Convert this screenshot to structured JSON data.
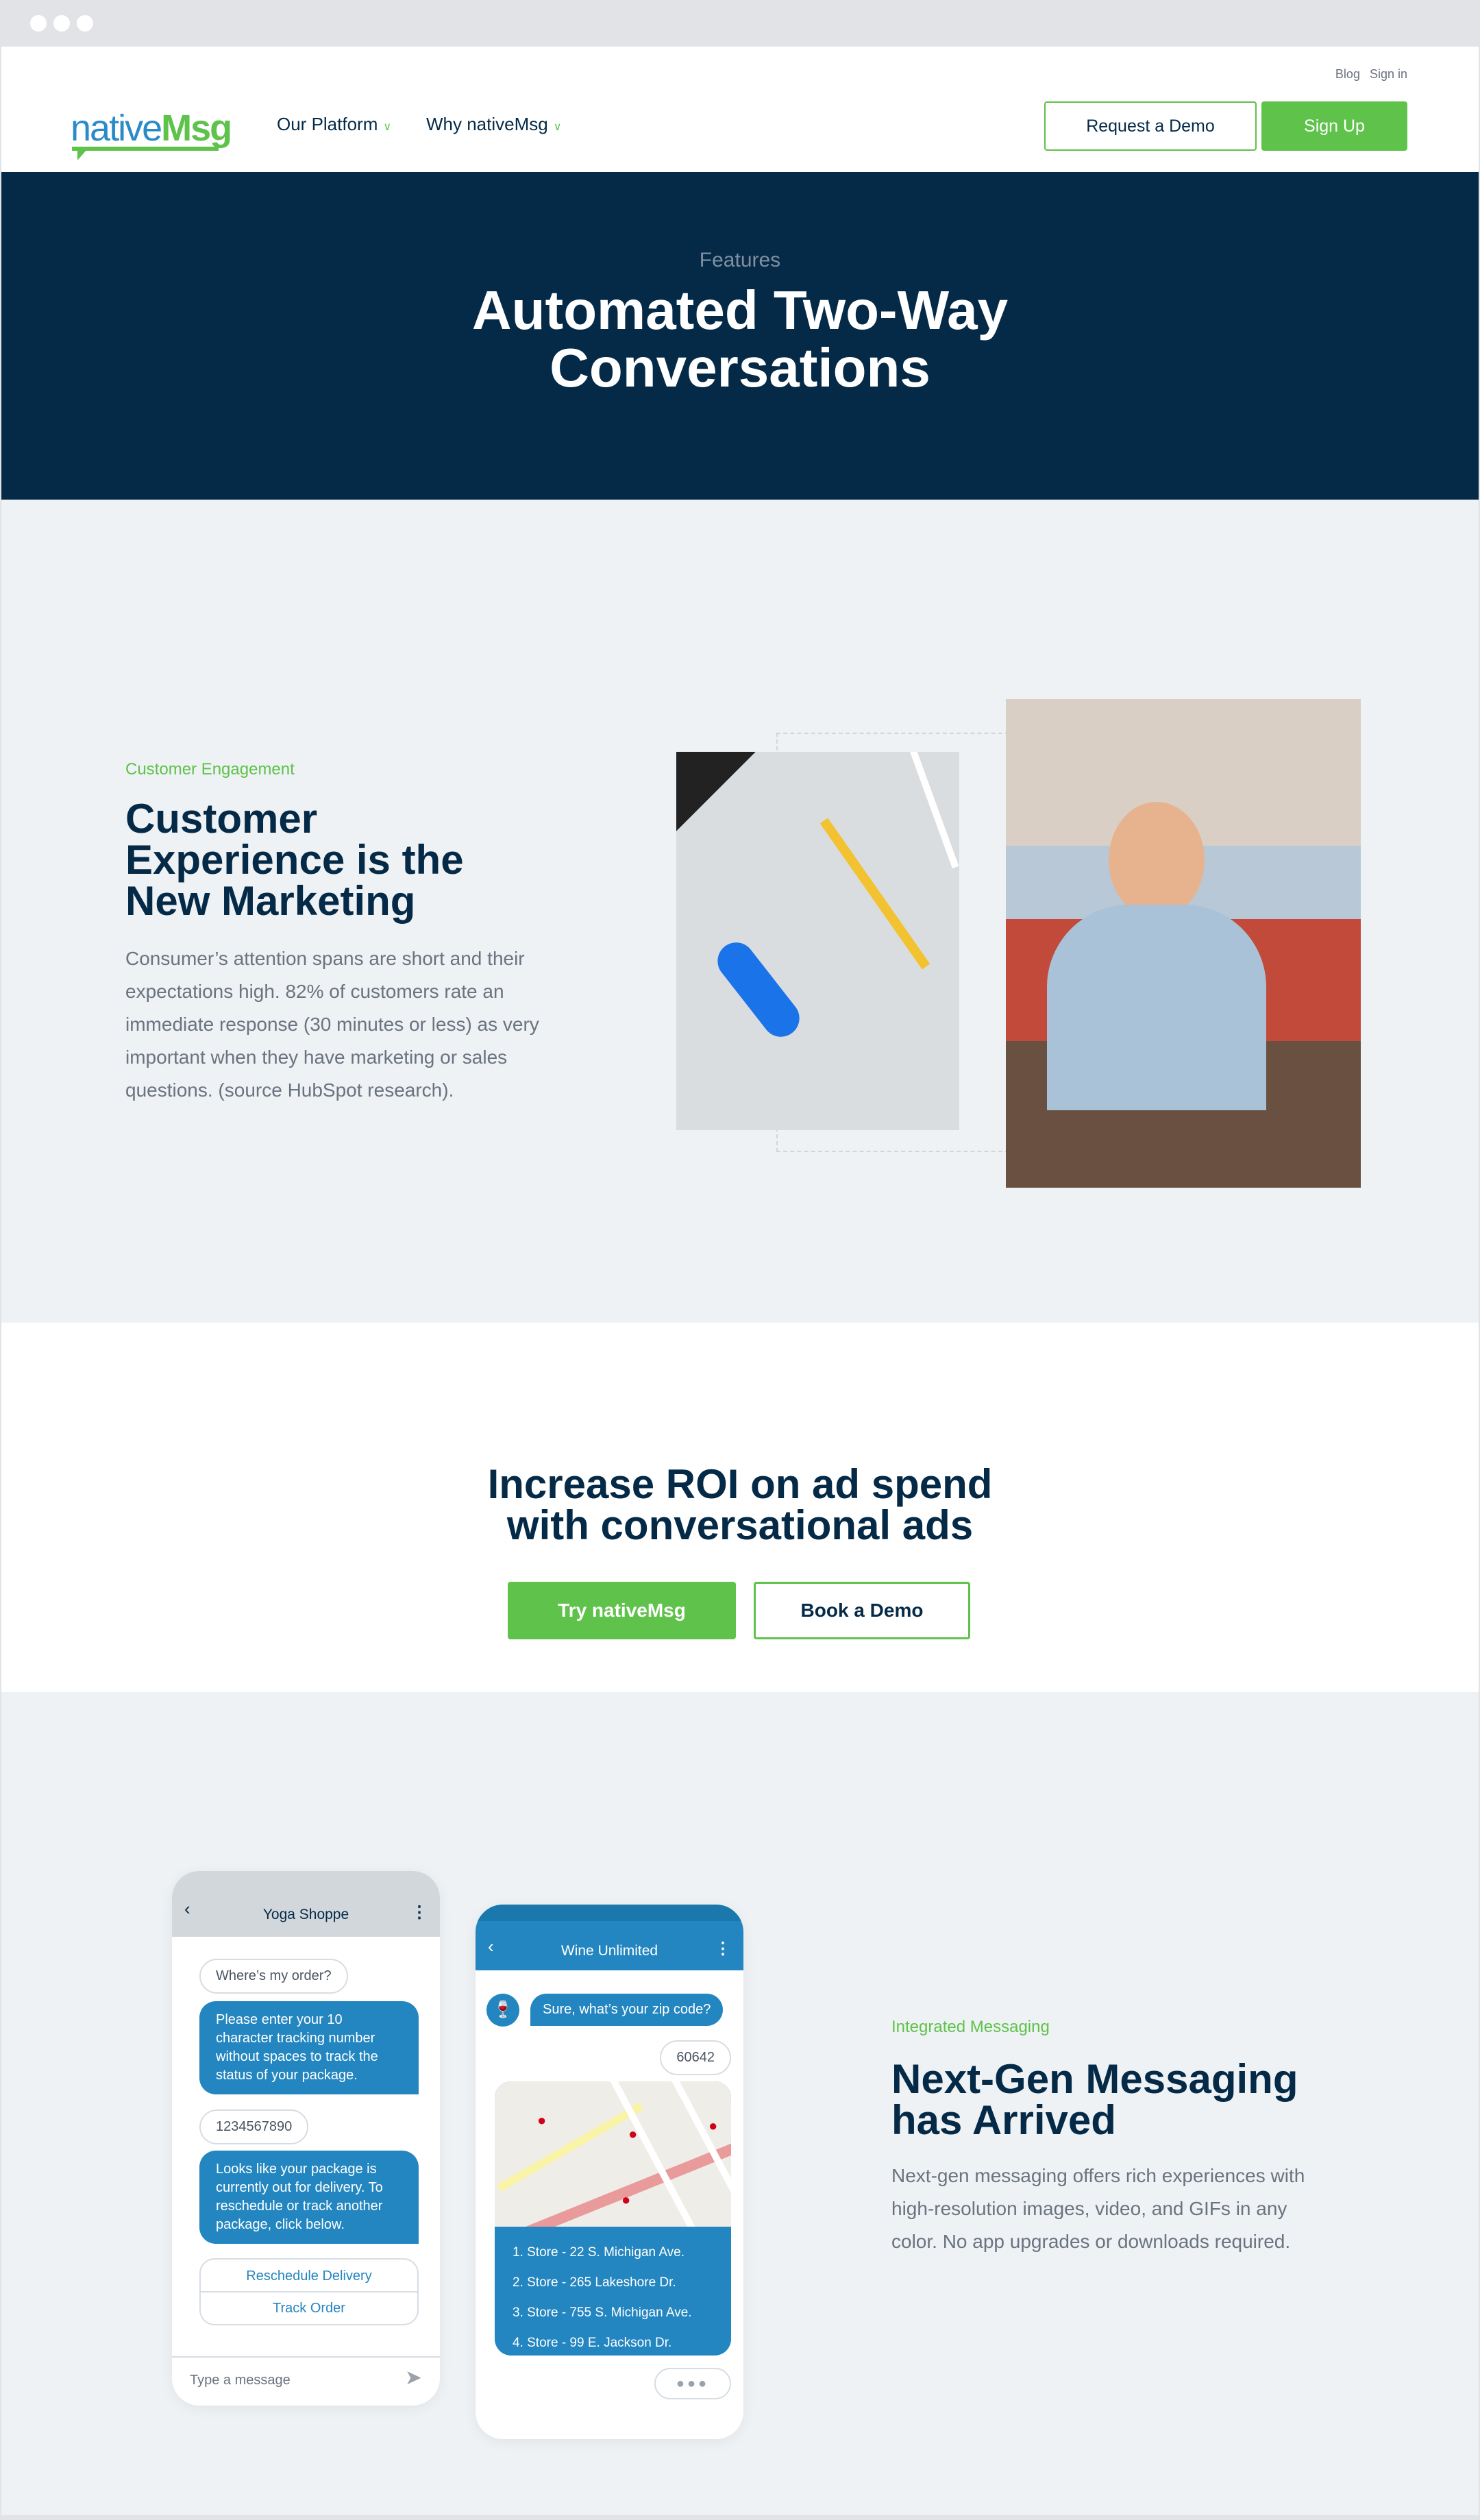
{
  "browser": {
    "dots": 3
  },
  "header": {
    "top_links": [
      "Blog",
      "Sign in"
    ],
    "logo": {
      "part1": "native",
      "part2": "Msg"
    },
    "nav": [
      {
        "label": "Our Platform"
      },
      {
        "label": "Why nativeMsg"
      }
    ],
    "request_demo": "Request a Demo",
    "sign_up": "Sign Up"
  },
  "hero": {
    "eyebrow": "Features",
    "title_line1": "Automated Two-Way",
    "title_line2": "Conversations"
  },
  "engagement": {
    "eyebrow": "Customer Engagement",
    "title_lines": [
      "Customer",
      "Experience is the",
      "New Marketing"
    ],
    "body": "Consumer’s attention spans are short and their expectations high. 82% of customers rate an immediate response (30 minutes or less) as very important when they have marketing or sales questions. (source HubSpot research)."
  },
  "cta": {
    "title_line1": "Increase ROI on ad spend",
    "title_line2": "with conversational ads",
    "primary": "Try nativeMsg",
    "secondary": "Book a Demo"
  },
  "messaging": {
    "eyebrow": "Integrated Messaging",
    "title_lines": [
      "Next-Gen Messaging",
      "has Arrived"
    ],
    "body": "Next-gen messaging offers rich experiences with high-resolution images, video, and GIFs in any color. No app upgrades or downloads required."
  },
  "yoga_phone": {
    "title": "Yoga Shoppe",
    "msg1": "Where’s my order?",
    "msg2": "Please enter your 10 character tracking number without spaces to track the status of your package.",
    "msg3": "1234567890",
    "msg4": "Looks like your package is currently out for delivery. To reschedule or track another package, click below.",
    "action1": "Reschedule Delivery",
    "action2": "Track Order",
    "input_placeholder": "Type a message"
  },
  "wine_phone": {
    "title": "Wine Unlimited",
    "msg1": "Sure, what’s your zip code?",
    "msg2": "60642",
    "stores": [
      "1. Store - 22 S. Michigan Ave.",
      "2. Store - 265 Lakeshore Dr.",
      "3. Store - 755 S. Michigan Ave.",
      "4. Store - 99 E. Jackson Dr."
    ]
  },
  "colors": {
    "navy": "#052a47",
    "green": "#5fc24a",
    "blue": "#2386c0",
    "light_bg": "#eef2f4"
  }
}
